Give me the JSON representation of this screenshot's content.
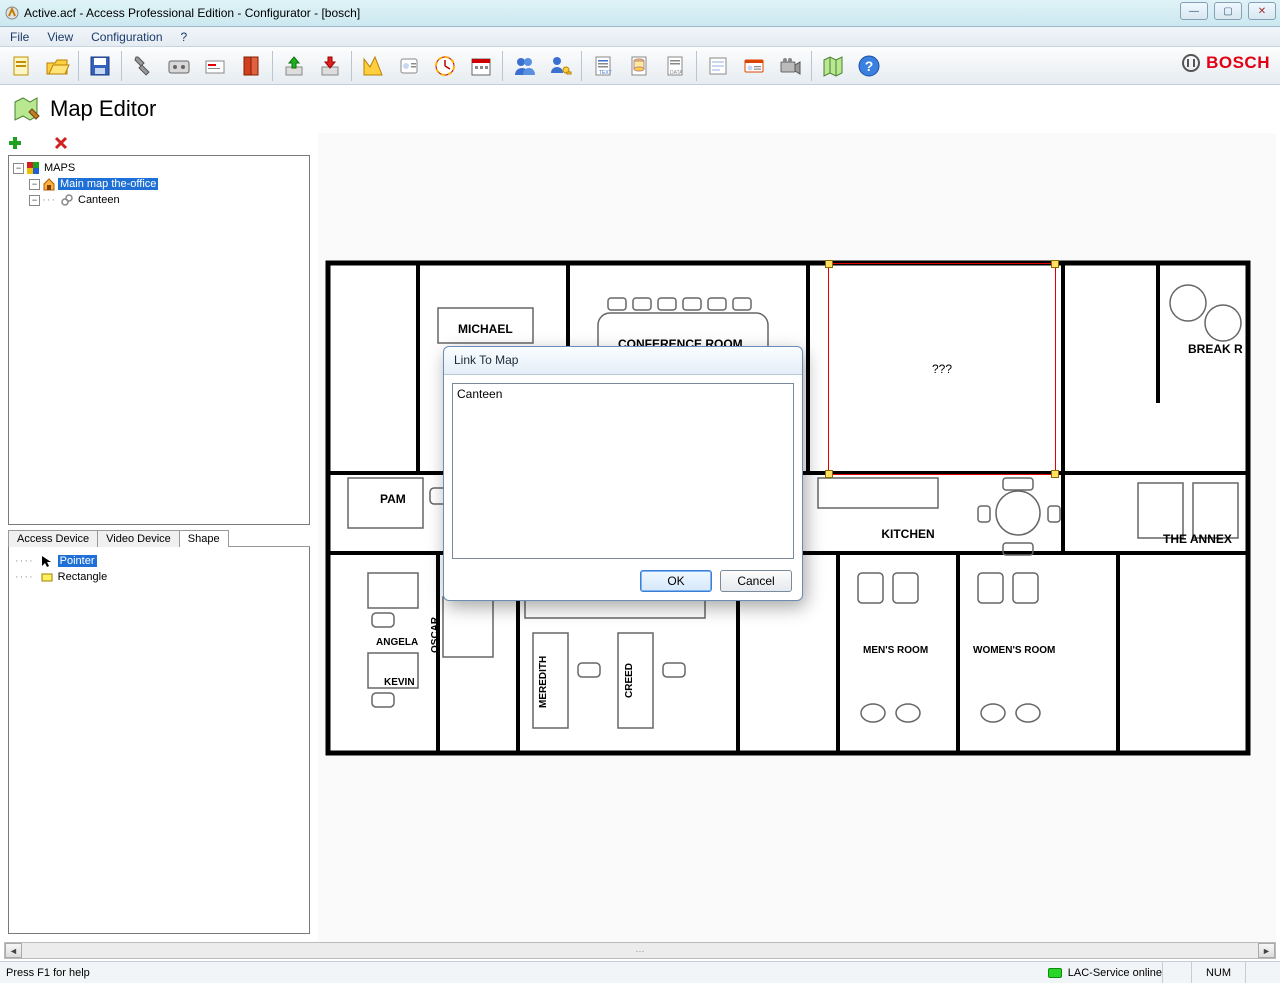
{
  "window": {
    "title": "Active.acf - Access Professional Edition - Configurator - [bosch]"
  },
  "menubar": {
    "items": [
      "File",
      "View",
      "Configuration",
      "?"
    ]
  },
  "brand": {
    "name": "BOSCH"
  },
  "editor": {
    "title": "Map Editor"
  },
  "tree": {
    "root_label": "MAPS",
    "items": [
      {
        "label": "Main map the-office",
        "selected": true
      },
      {
        "label": "Canteen",
        "selected": false
      }
    ]
  },
  "tabs": {
    "items": [
      "Access Device",
      "Video Device",
      "Shape"
    ],
    "active": 2
  },
  "palette": {
    "items": [
      {
        "label": "Pointer",
        "selected": true
      },
      {
        "label": "Rectangle",
        "selected": false
      }
    ]
  },
  "selection": {
    "label": "???"
  },
  "floorplan": {
    "rooms": [
      "MICHAEL",
      "CONFERENCE ROOM",
      "BREAK R",
      "PAM",
      "KITCHEN",
      "THE ANNEX",
      "ANGELA",
      "OSCAR",
      "KEVIN",
      "MEREDITH",
      "CREED",
      "MEN'S ROOM",
      "WOMEN'S ROOM"
    ]
  },
  "dialog": {
    "title": "Link To Map",
    "list_item": "Canteen",
    "ok": "OK",
    "cancel": "Cancel"
  },
  "statusbar": {
    "help": "Press F1 for help",
    "service": "LAC-Service online",
    "num": "NUM"
  }
}
